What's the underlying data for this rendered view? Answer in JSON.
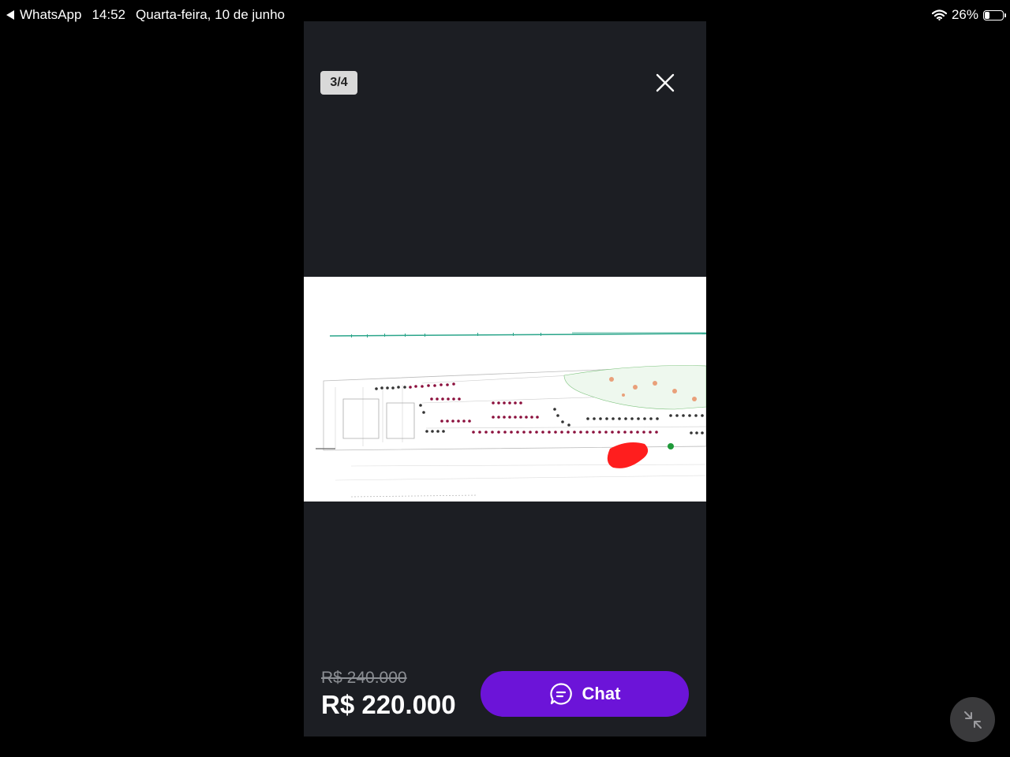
{
  "status_bar": {
    "back_app": "WhatsApp",
    "time": "14:52",
    "date": "Quarta-feira, 10 de junho",
    "battery": "26%",
    "battery_level": 0.26
  },
  "viewer": {
    "counter": "3/4",
    "old_price": "R$ 240.000",
    "price": "R$ 220.000",
    "chat_label": "Chat"
  },
  "icons": {
    "back": "back-arrow-icon",
    "wifi": "wifi-icon",
    "battery": "battery-icon",
    "close": "close-icon",
    "chat": "chat-bubble-icon",
    "minimize": "minimize-icon"
  },
  "colors": {
    "chat_button": "#6c14d8",
    "viewer_bg": "#1c1e23",
    "lot_available": "#8b0f3c",
    "lot_sold": "#333333",
    "highlight": "#ff1e1e",
    "plan_line": "#2aa58a"
  }
}
